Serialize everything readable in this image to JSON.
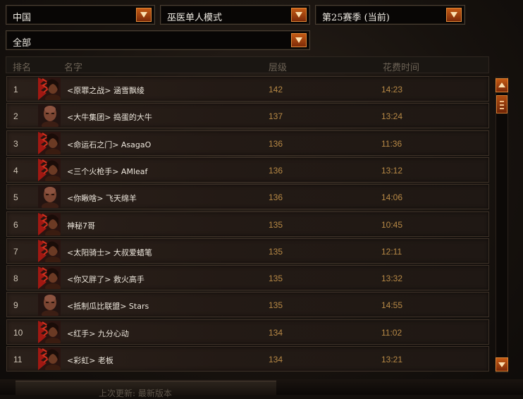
{
  "filters": {
    "region": "中国",
    "mode": "巫医单人模式",
    "season": "第25赛季 (当前)",
    "class": "全部"
  },
  "columns": {
    "rank": "排名",
    "name": "名字",
    "tier": "层级",
    "time": "花费时间"
  },
  "rows": [
    {
      "rank": "1",
      "name": "<原罪之战> 涵雪飘绫",
      "tier": "142",
      "time": "14:23",
      "portrait": "tribal"
    },
    {
      "rank": "2",
      "name": "<大牛集团> 捣蛋的大牛",
      "tier": "137",
      "time": "13:24",
      "portrait": "bald"
    },
    {
      "rank": "3",
      "name": "<命运石之门> AsagaO",
      "tier": "136",
      "time": "11:36",
      "portrait": "tribal"
    },
    {
      "rank": "4",
      "name": "<三个火枪手> AMleaf",
      "tier": "136",
      "time": "13:12",
      "portrait": "tribal"
    },
    {
      "rank": "5",
      "name": "<你瞅啥> 飞天绵羊",
      "tier": "136",
      "time": "14:06",
      "portrait": "bald"
    },
    {
      "rank": "6",
      "name": "神秘7哥",
      "tier": "135",
      "time": "10:45",
      "portrait": "tribal"
    },
    {
      "rank": "7",
      "name": "<太阳骑士> 大叔爱蜡笔",
      "tier": "135",
      "time": "12:11",
      "portrait": "tribal"
    },
    {
      "rank": "8",
      "name": "<你又胖了> 救火高手",
      "tier": "135",
      "time": "13:32",
      "portrait": "tribal"
    },
    {
      "rank": "9",
      "name": "<抵制瓜比联盟> Stars",
      "tier": "135",
      "time": "14:55",
      "portrait": "bald"
    },
    {
      "rank": "10",
      "name": "<红手> 九分心动",
      "tier": "134",
      "time": "11:02",
      "portrait": "tribal"
    },
    {
      "rank": "11",
      "name": "<彩虹> 老板",
      "tier": "134",
      "time": "13:21",
      "portrait": "tribal"
    }
  ],
  "footer": {
    "text": "上次更新: 最新版本"
  },
  "colors": {
    "accent": "#c45a14",
    "value_text": "#b88a46",
    "header_text": "#6d6356"
  }
}
